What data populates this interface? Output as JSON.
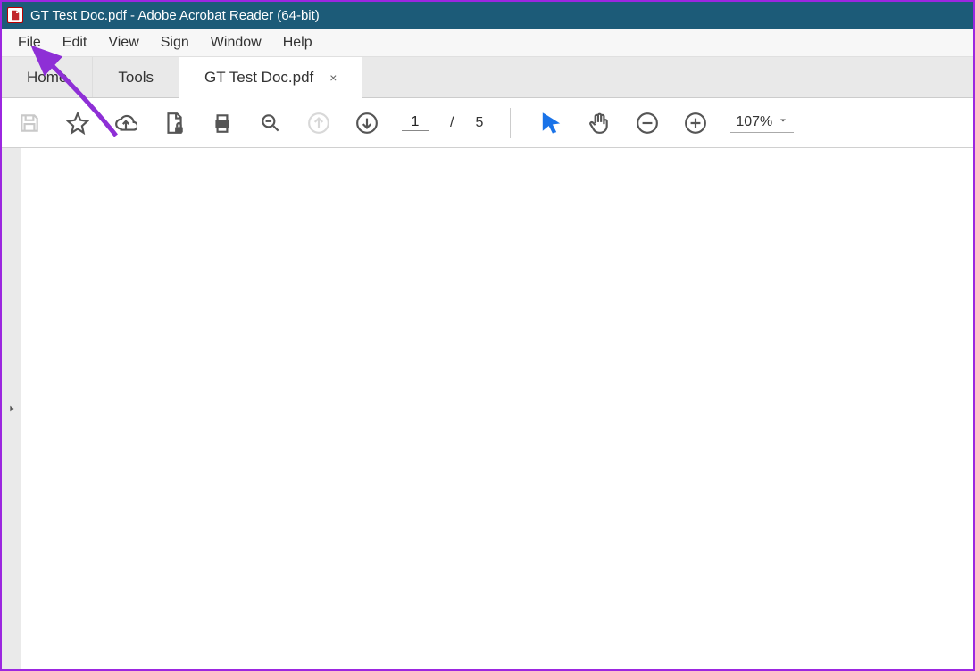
{
  "titlebar": {
    "title": "GT Test Doc.pdf - Adobe Acrobat Reader (64-bit)"
  },
  "menubar": {
    "items": [
      "File",
      "Edit",
      "View",
      "Sign",
      "Window",
      "Help"
    ]
  },
  "tabs": {
    "home": "Home",
    "tools": "Tools",
    "doc": "GT Test Doc.pdf",
    "close_glyph": "×"
  },
  "toolbar": {
    "page_current": "1",
    "page_sep": "/",
    "page_total": "5",
    "zoom_level": "107%"
  }
}
